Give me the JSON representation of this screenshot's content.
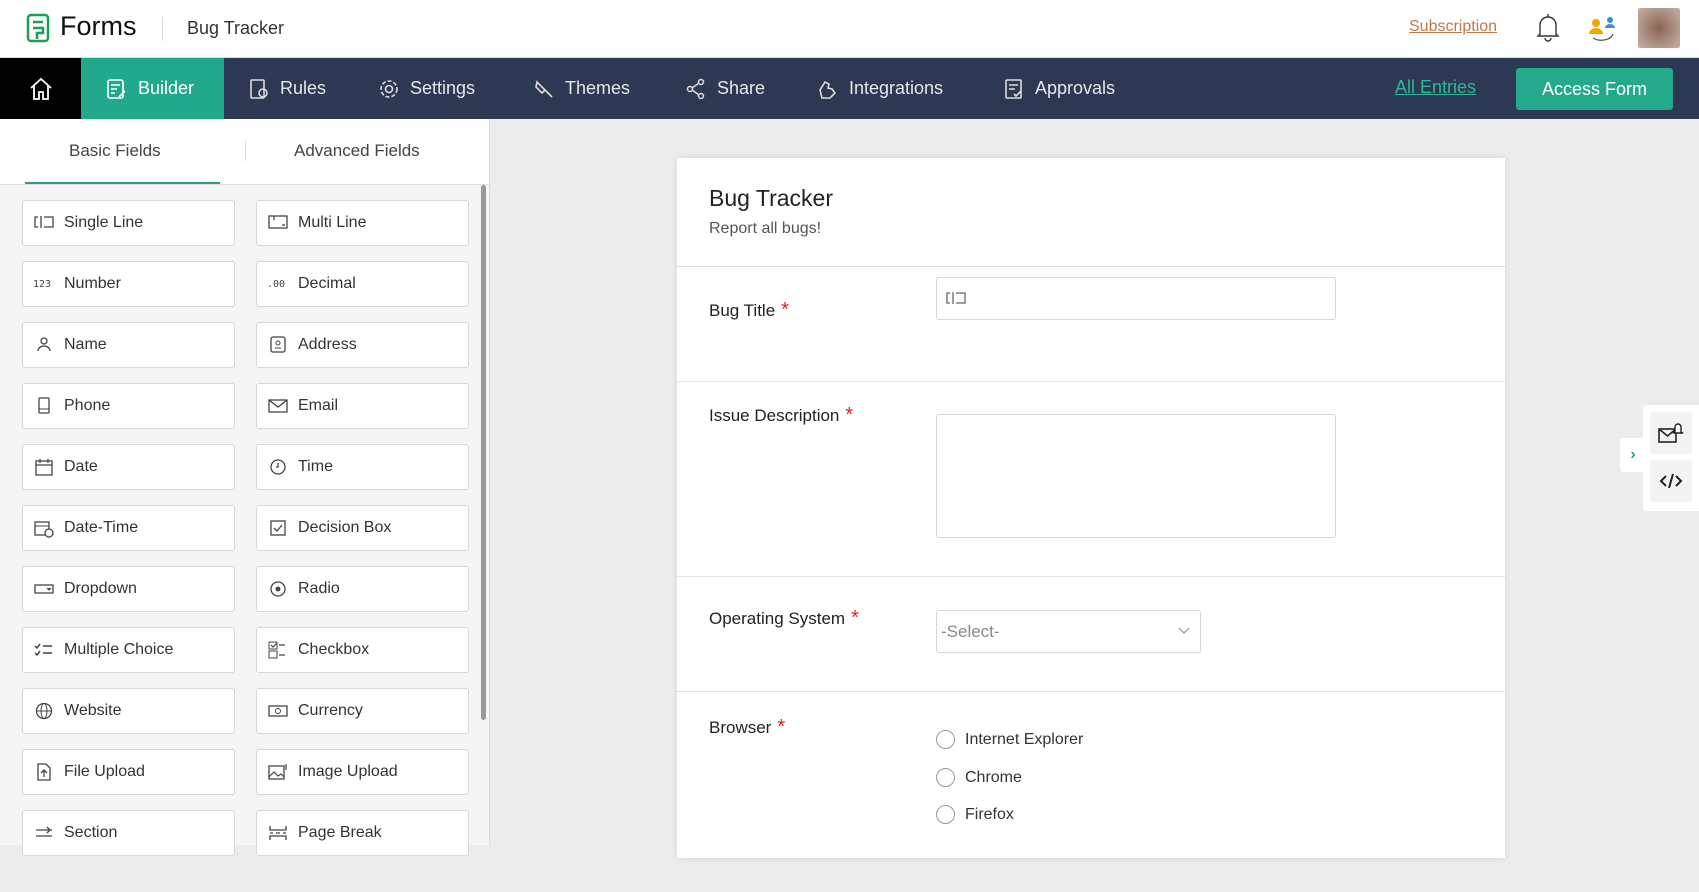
{
  "header": {
    "brand": "Forms",
    "form_name": "Bug Tracker",
    "subscription": "Subscription"
  },
  "nav": {
    "items": [
      {
        "label": "Builder"
      },
      {
        "label": "Rules"
      },
      {
        "label": "Settings"
      },
      {
        "label": "Themes"
      },
      {
        "label": "Share"
      },
      {
        "label": "Integrations"
      },
      {
        "label": "Approvals"
      }
    ],
    "all_entries": "All Entries",
    "access_form": "Access Form"
  },
  "sidebar": {
    "tabs": [
      "Basic Fields",
      "Advanced Fields"
    ],
    "fields": [
      "Single Line",
      "Multi Line",
      "Number",
      "Decimal",
      "Name",
      "Address",
      "Phone",
      "Email",
      "Date",
      "Time",
      "Date-Time",
      "Decision Box",
      "Dropdown",
      "Radio",
      "Multiple Choice",
      "Checkbox",
      "Website",
      "Currency",
      "File Upload",
      "Image Upload",
      "Section",
      "Page Break"
    ]
  },
  "form": {
    "title": "Bug Tracker",
    "subtitle": "Report all bugs!",
    "fields": [
      {
        "label": "Bug Title",
        "required": "*"
      },
      {
        "label": "Issue Description",
        "required": "*"
      },
      {
        "label": "Operating System",
        "required": "*",
        "placeholder": "-Select-"
      },
      {
        "label": "Browser",
        "required": "*",
        "options": [
          "Internet Explorer",
          "Chrome",
          "Firefox"
        ]
      }
    ]
  },
  "colors": {
    "accent": "#22a88a",
    "nav": "#2d3852",
    "required": "#e02020"
  }
}
